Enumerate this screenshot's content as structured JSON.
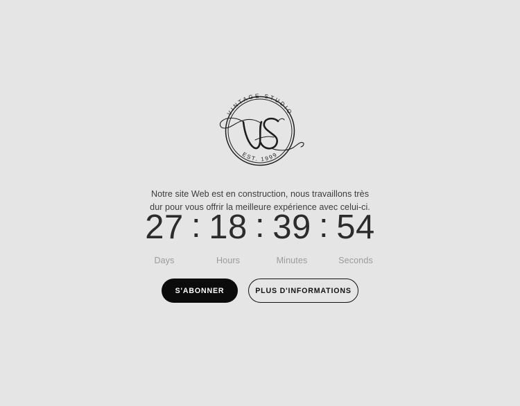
{
  "page": {
    "background_color": "#e6e5e5",
    "text_color": "#3b3b3b"
  },
  "logo": {
    "name": "vintage-studio-monogram",
    "top_arc_text": "VINTAGE STUDIO",
    "bottom_arc_text": "EST. 1999",
    "monogram": "VS",
    "stroke_color": "#1d1d1d"
  },
  "intro": {
    "text": "Notre site Web est en construction, nous travaillons très dur pour vous offrir la meilleure expérience avec celui-ci."
  },
  "countdown": {
    "separator": ":",
    "units": [
      {
        "value": "27",
        "label": "Days"
      },
      {
        "value": "18",
        "label": "Hours"
      },
      {
        "value": "39",
        "label": "Minutes"
      },
      {
        "value": "54",
        "label": "Seconds"
      }
    ]
  },
  "buttons": {
    "primary_label": "S'ABONNER",
    "secondary_label": "PLUS D'INFORMATIONS",
    "primary_bg": "#0b0b0b",
    "primary_fg": "#ffffff",
    "secondary_border": "#111111"
  }
}
